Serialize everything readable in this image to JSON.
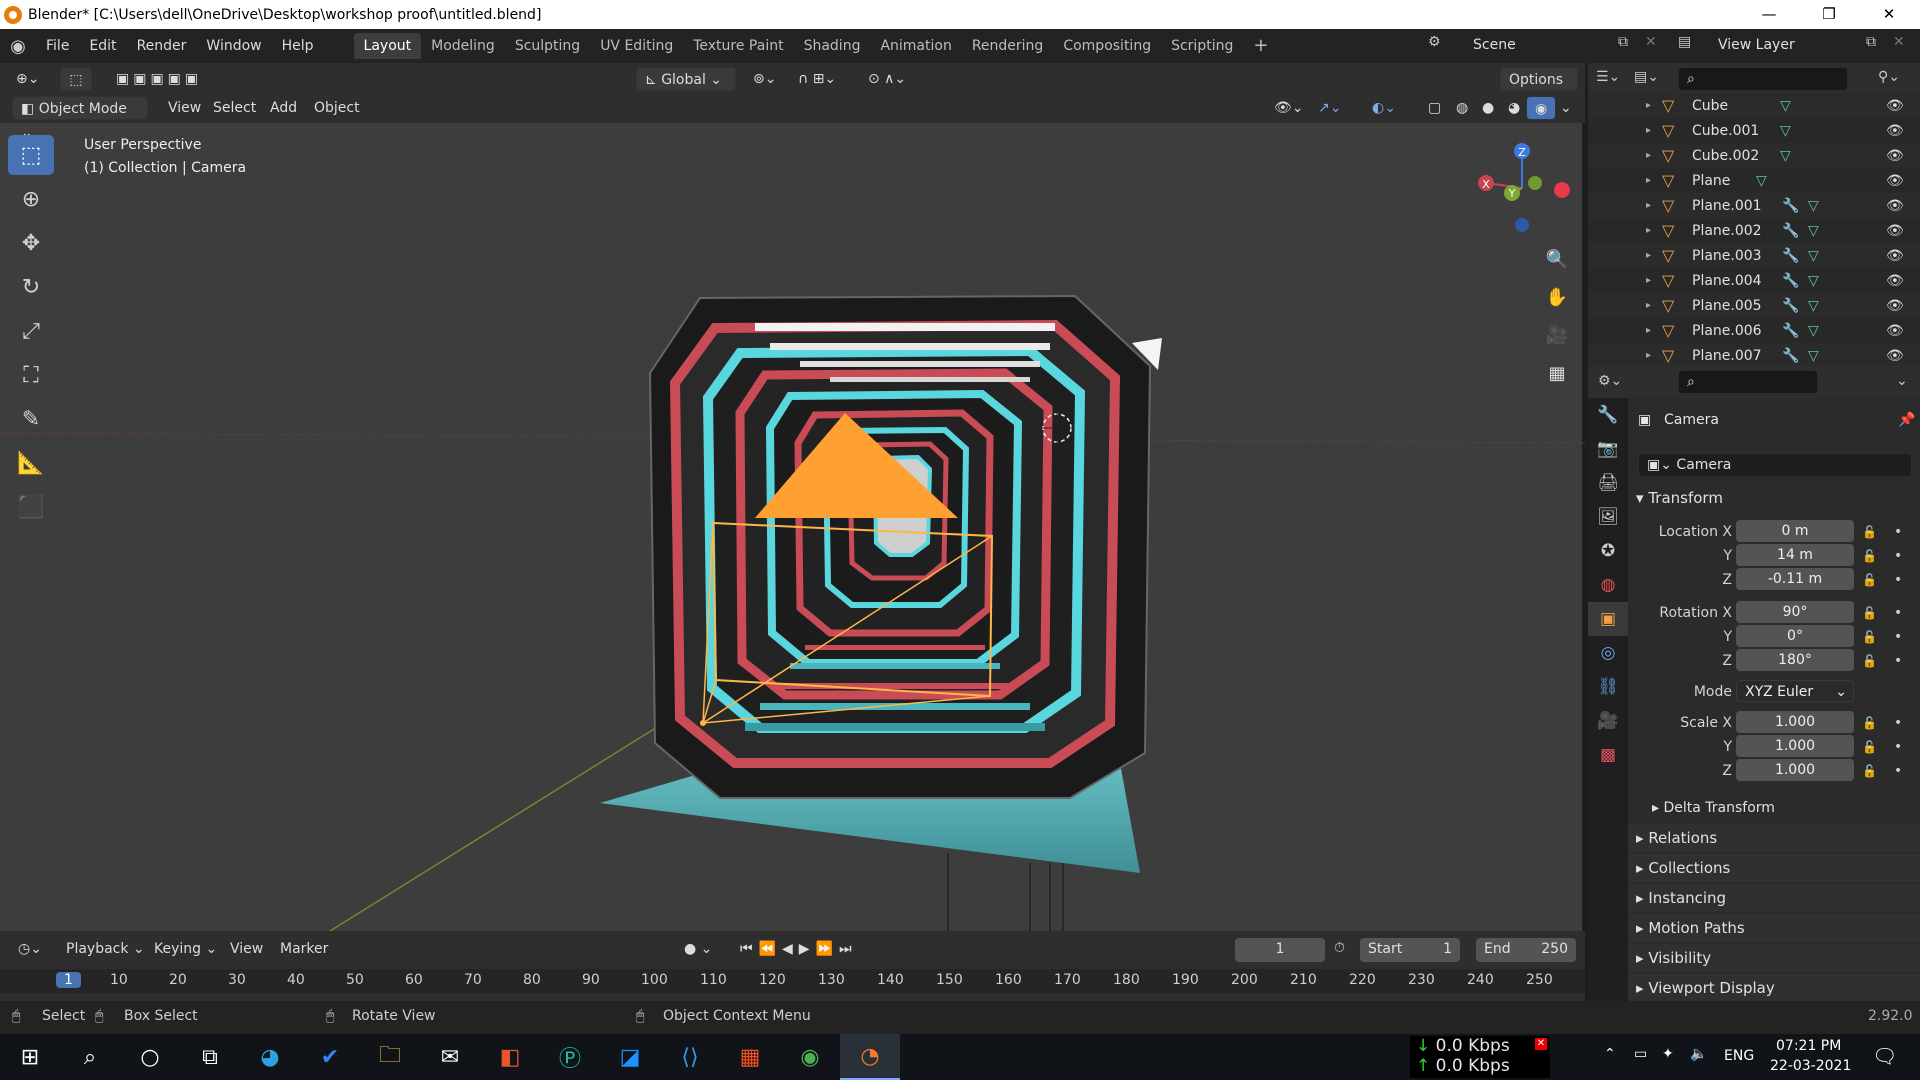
{
  "window": {
    "title": "Blender* [C:\\Users\\dell\\OneDrive\\Desktop\\workshop proof\\untitled.blend]",
    "minimize": "—",
    "maximize": "❐",
    "close": "✕"
  },
  "topbar": {
    "menus": [
      "File",
      "Edit",
      "Render",
      "Window",
      "Help"
    ],
    "workspaces": [
      "Layout",
      "Modeling",
      "Sculpting",
      "UV Editing",
      "Texture Paint",
      "Shading",
      "Animation",
      "Rendering",
      "Compositing",
      "Scripting"
    ],
    "add_workspace": "+",
    "scene": "Scene",
    "view_layer": "View Layer"
  },
  "viewport": {
    "mode": "Object Mode",
    "menus": [
      "View",
      "Select",
      "Add",
      "Object"
    ],
    "transform_orientation": "Global",
    "options": "Options",
    "overlay_title": "User Perspective",
    "overlay_sub": "(1) Collection | Camera",
    "gizmo": {
      "x": "X",
      "y": "Y",
      "z": "Z"
    }
  },
  "timeline": {
    "menus": [
      "Playback",
      "Keying",
      "View",
      "Marker"
    ],
    "current_frame": "1",
    "start_label": "Start",
    "start": "1",
    "end_label": "End",
    "end": "250",
    "ticks": [
      "1",
      "10",
      "20",
      "30",
      "40",
      "50",
      "60",
      "70",
      "80",
      "90",
      "100",
      "110",
      "120",
      "130",
      "140",
      "150",
      "160",
      "170",
      "180",
      "190",
      "200",
      "210",
      "220",
      "230",
      "240",
      "250"
    ]
  },
  "statusbar": {
    "select": "Select",
    "box_select": "Box Select",
    "rotate_view": "Rotate View",
    "context_menu": "Object Context Menu",
    "version": "2.92.0"
  },
  "outliner": {
    "items": [
      {
        "name": "Cube",
        "modifier": false
      },
      {
        "name": "Cube.001",
        "modifier": false
      },
      {
        "name": "Cube.002",
        "modifier": false
      },
      {
        "name": "Plane",
        "modifier": false
      },
      {
        "name": "Plane.001",
        "modifier": true
      },
      {
        "name": "Plane.002",
        "modifier": true
      },
      {
        "name": "Plane.003",
        "modifier": true
      },
      {
        "name": "Plane.004",
        "modifier": true
      },
      {
        "name": "Plane.005",
        "modifier": true
      },
      {
        "name": "Plane.006",
        "modifier": true
      },
      {
        "name": "Plane.007",
        "modifier": true
      }
    ]
  },
  "properties": {
    "object_name": "Camera",
    "object_field": "Camera",
    "transform_label": "Transform",
    "location_label": "Location X",
    "loc_x": "0 m",
    "loc_y": "14 m",
    "loc_z": "-0.11 m",
    "rotation_label": "Rotation X",
    "rot_x": "90°",
    "rot_y": "0°",
    "rot_z": "180°",
    "mode_label": "Mode",
    "mode_value": "XYZ Euler",
    "scale_label": "Scale X",
    "scale_x": "1.000",
    "scale_y": "1.000",
    "scale_z": "1.000",
    "y_label": "Y",
    "z_label": "Z",
    "delta_transform": "Delta Transform",
    "sections": [
      "Relations",
      "Collections",
      "Instancing",
      "Motion Paths",
      "Visibility",
      "Viewport Display"
    ]
  },
  "taskbar": {
    "net_down": "0.0 Kbps",
    "net_up": "0.0 Kbps",
    "lang": "ENG",
    "time": "07:21 PM",
    "date": "22-03-2021"
  },
  "colors": {
    "accent": "#4772b3",
    "object_orange": "#ffa033",
    "cyan": "#5ee0e6",
    "red": "#d04a55"
  }
}
